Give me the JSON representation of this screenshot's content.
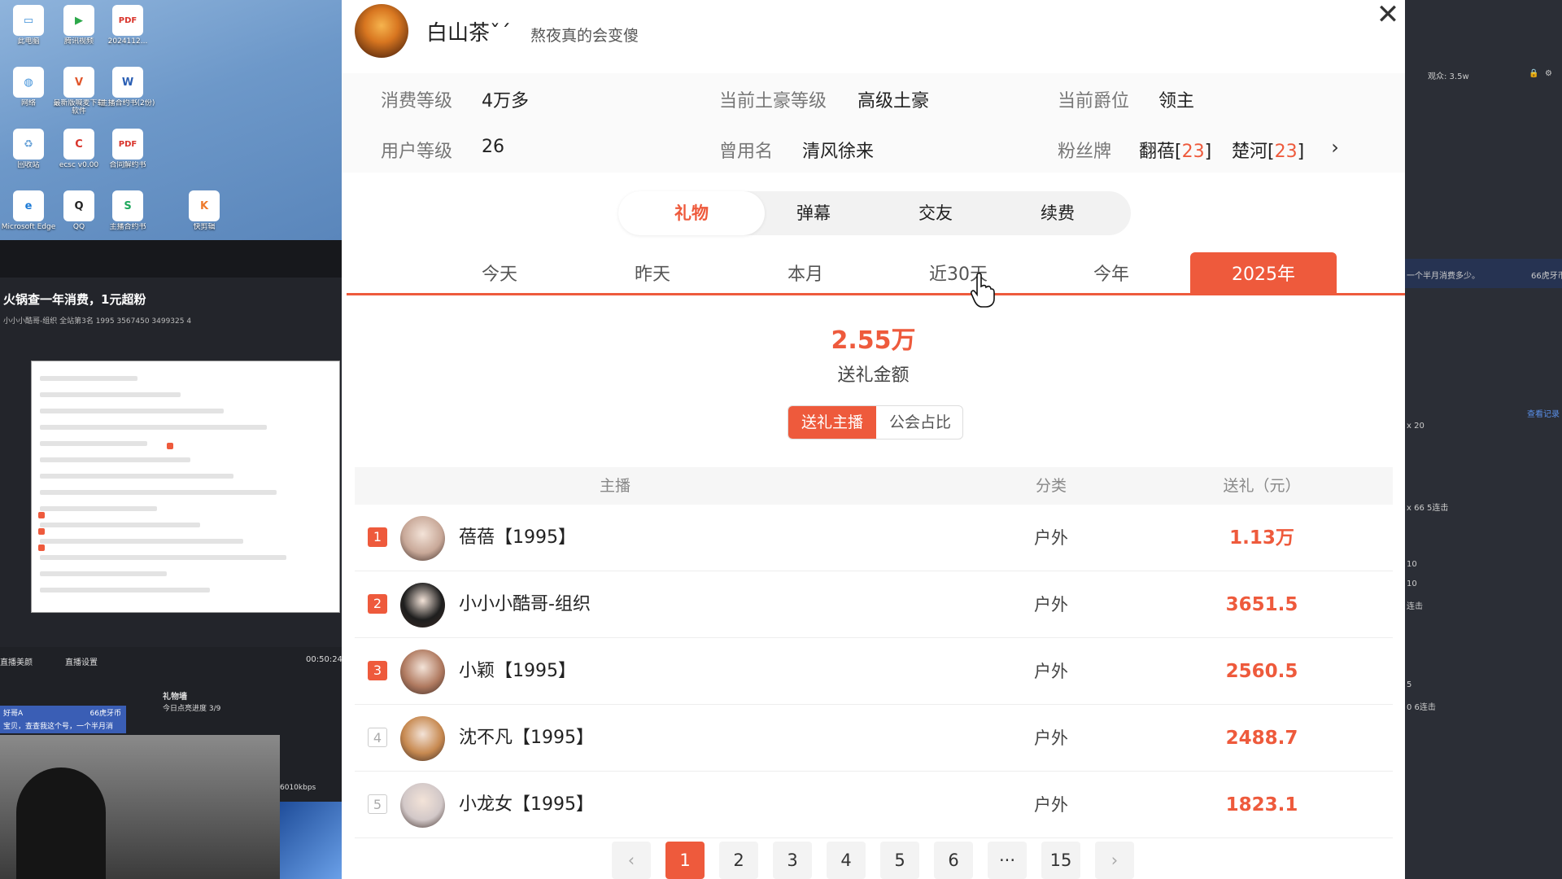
{
  "desktop": {
    "icons": [
      {
        "label": "此电脑",
        "glyph": "▭",
        "color": "#3d8fd8"
      },
      {
        "label": "腾讯视频",
        "glyph": "▶",
        "color": "#2ca84a"
      },
      {
        "label": "2024112...",
        "glyph": "PDF",
        "color": "#d9342b"
      },
      {
        "label": "网络",
        "glyph": "◍",
        "color": "#3d8fd8"
      },
      {
        "label": "最新版喊麦下载软件",
        "glyph": "V",
        "color": "#e1562b"
      },
      {
        "label": "主播合约书(2份)",
        "glyph": "W",
        "color": "#2b5fb4"
      },
      {
        "label": "回收站",
        "glyph": "♻",
        "color": "#6aa3d8"
      },
      {
        "label": "ecsc v0.00",
        "glyph": "C",
        "color": "#d9342b"
      },
      {
        "label": "合同解约书",
        "glyph": "PDF",
        "color": "#d9342b"
      },
      {
        "label": "Microsoft Edge",
        "glyph": "e",
        "color": "#1b7ad6"
      },
      {
        "label": "QQ",
        "glyph": "Q",
        "color": "#222"
      },
      {
        "label": "主播合约书",
        "glyph": "S",
        "color": "#1ea85c"
      },
      {
        "label": "快剪辑",
        "glyph": "K",
        "color": "#ee7a2c"
      }
    ]
  },
  "stream": {
    "title": "火锅查一年消费，1元超粉",
    "meta": "小小小酷哥-组织  全站第3名  1995  3567450  3499325  4",
    "tools": [
      "直播美颜",
      "直播设置",
      "00:50:24"
    ],
    "gift_wall": "礼物墙",
    "gift_progress": "今日点亮进度 3/9",
    "chat_user": "好哥A",
    "chat_amount": "66虎牙币",
    "chat_text": "宝贝，查查我这个号，一个半月消",
    "bitrate": "6010kbps"
  },
  "right_panel": {
    "viewers": "观众: 3.5w",
    "msg": "一个半月消费多少。",
    "coins": "66虎牙币",
    "view_record": "查看记录",
    "lines": [
      "x 20",
      "x 66 5连击",
      "10",
      "10",
      "连击",
      "5",
      "0 6连击"
    ]
  },
  "profile": {
    "name": "白山茶ˇˊ",
    "signature": "熬夜真的会变傻",
    "close_label": "✕",
    "consume_level_label": "消费等级",
    "consume_level_value": "4万多",
    "tycoon_label": "当前土豪等级",
    "tycoon_value": "高级土豪",
    "title_label": "当前爵位",
    "title_value": "领主",
    "user_level_label": "用户等级",
    "user_level_value": "26",
    "former_name_label": "曾用名",
    "former_name_value": "清风徐来",
    "fan_badge_label": "粉丝牌",
    "fan_badges": [
      {
        "name": "翻蓓",
        "level": "23"
      },
      {
        "name": "楚河",
        "level": "23"
      }
    ],
    "more_icon": "›"
  },
  "main_tabs": [
    "礼物",
    "弹幕",
    "交友",
    "续费"
  ],
  "period_tabs": [
    "今天",
    "昨天",
    "本月",
    "近30天",
    "今年",
    "2025年"
  ],
  "summary": {
    "total": "2.55万",
    "label": "送礼金额"
  },
  "sub_tabs": [
    "送礼主播",
    "公会占比"
  ],
  "table": {
    "headers": [
      "主播",
      "分类",
      "送礼（元）"
    ],
    "rows": [
      {
        "rank": "1",
        "name": "蓓蓓【1995】",
        "category": "户外",
        "amount": "1.13万",
        "avatar": "#c8a898"
      },
      {
        "rank": "2",
        "name": "小小小酷哥-组织",
        "category": "户外",
        "amount": "3651.5",
        "avatar": "#1e1e1e"
      },
      {
        "rank": "3",
        "name": "小颖【1995】",
        "category": "户外",
        "amount": "2560.5",
        "avatar": "#b07a60"
      },
      {
        "rank": "4",
        "name": "沈不凡【1995】",
        "category": "户外",
        "amount": "2488.7",
        "avatar": "#c78950"
      },
      {
        "rank": "5",
        "name": "小龙女【1995】",
        "category": "户外",
        "amount": "1823.1",
        "avatar": "#d2c8c8"
      }
    ]
  },
  "pagination": {
    "prev": "‹",
    "pages": [
      "1",
      "2",
      "3",
      "4",
      "5",
      "6",
      "···",
      "15"
    ],
    "next": "›"
  },
  "colors": {
    "accent": "#ee5a3c",
    "text": "#222222",
    "muted": "#777777"
  }
}
